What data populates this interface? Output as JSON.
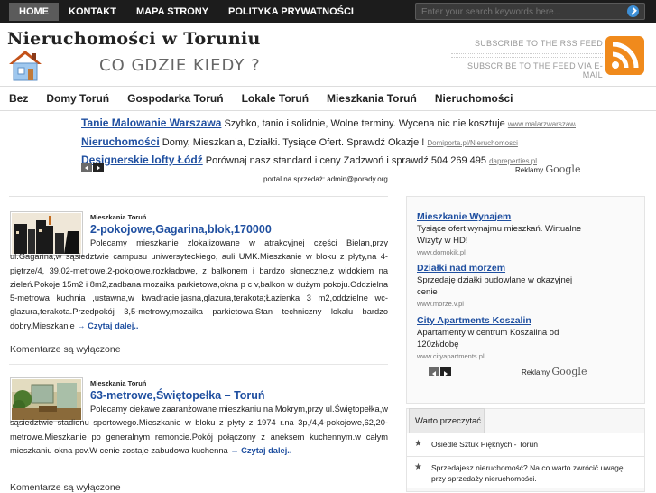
{
  "top_nav": {
    "items": [
      "HOME",
      "KONTAKT",
      "MAPA STRONY",
      "POLITYKA PRYWATNOŚCI"
    ],
    "search_placeholder": "Enter your search keywords here..."
  },
  "header": {
    "site_title": "Nieruchomości w Toruniu",
    "slogan": "CO GDZIE KIEDY ?",
    "subscribe_rss": "SUBSCRIBE TO THE RSS FEED",
    "subscribe_email": "SUBSCRIBE TO THE FEED VIA E-MAIL"
  },
  "category_nav": [
    "Bez",
    "Domy Toruń",
    "Gospodarka Toruń",
    "Lokale Toruń",
    "Mieszkania Toruń",
    "Nieruchomości"
  ],
  "ads_top": [
    {
      "title": "Tanie Malowanie Warszawa",
      "desc": "Szybko, tanio i solidnie, Wolne terminy. Wycena nic nie kosztuje",
      "url": "www.malarzwarszawa.pl/ol"
    },
    {
      "title": "Nieruchomości",
      "desc": "Domy, Mieszkania, Działki. Tysiące Ofert. Sprawdź Okazje !",
      "url": "Domiporta.pl/Nieruchomosci"
    },
    {
      "title": "Designerskie lofty Łódź",
      "desc": "Porównaj nasz standard i ceny Zadzwoń i sprawdź 504 269 495",
      "url": "dapreperties.pl"
    }
  ],
  "ads_label": "Reklamy",
  "ads_brand": "Google",
  "portal_notice": "portal na sprzedaż: admin@porady.org",
  "posts": [
    {
      "category": "Mieszkania Toruń",
      "title": "2-pokojowe,Gagarina,blok,170000",
      "body": "Polecamy mieszkanie zlokalizowane w atrakcyjnej części Bielan,przy ul.Gagarina,w sąsiedztwie campusu uniwersyteckiego, auli UMK.Mieszkanie w bloku z płyty,na 4-piętrze/4, 39,02-metrowe.2-pokojowe,rozkładowe, z balkonem i bardzo słoneczne,z widokiem na zieleń.Pokoje 15m2 i 8m2,zadbana mozaika parkietowa,okna p c v,balkon w dużym pokoju.Oddzielna 5-metrowa kuchnia ,ustawna,w kwadracie,jasna,glazura,terakota;Łazienka 3 m2,oddzielne wc-glazura,terakota.Przedpokój 3,5-metrowy,mozaika parkietowa.Stan techniczny lokalu bardzo dobry.Mieszkanie",
      "more": "→ Czytaj dalej..",
      "comments": "Komentarze są wyłączone"
    },
    {
      "category": "Mieszkania Toruń",
      "title": "63-metrowe,Świętopełka – Toruń",
      "body": "Polecamy ciekawe zaaranżowane mieszkaniu na Mokrym,przy ul.Świętopełka,w sąsiedztwie stadionu sportowego.Mieszkanie w bloku z płyty z 1974 r.na 3p,/4,4-pokojowe,62,20-metrowe.Mieszkanie po generalnym remoncie.Pokój połączony z aneksem kuchennym.w całym mieszkaniu okna pcv.W cenie zostaje zabudowa kuchenna",
      "more": "→ Czytaj dalej..",
      "comments": "Komentarze są wyłączone"
    }
  ],
  "sidebar_ads": [
    {
      "title": "Mieszkanie Wynajem",
      "desc": "Tysiące ofert wynajmu mieszkań. Wirtualne Wizyty w HD!",
      "url": "www.domokik.pl"
    },
    {
      "title": "Działki nad morzem",
      "desc": "Sprzedaję działki budowlane w okazyjnej cenie",
      "url": "www.morze.v.pl"
    },
    {
      "title": "City Apartments Koszalin",
      "desc": "Apartamenty w centrum Koszalina od 120zł/dobę",
      "url": "www.cityapartments.pl"
    }
  ],
  "worth_reading": {
    "tab_label": "Warto przeczytać",
    "items": [
      "Osiedle Sztuk Pięknych - Toruń",
      "Sprzedajesz nieruchomość? Na co warto zwrócić uwagę przy sprzedaży nieruchomości."
    ]
  },
  "colors": {
    "link": "#1f4fa0",
    "topbar": "#1c1c1c",
    "rss": "#f08a1c"
  }
}
